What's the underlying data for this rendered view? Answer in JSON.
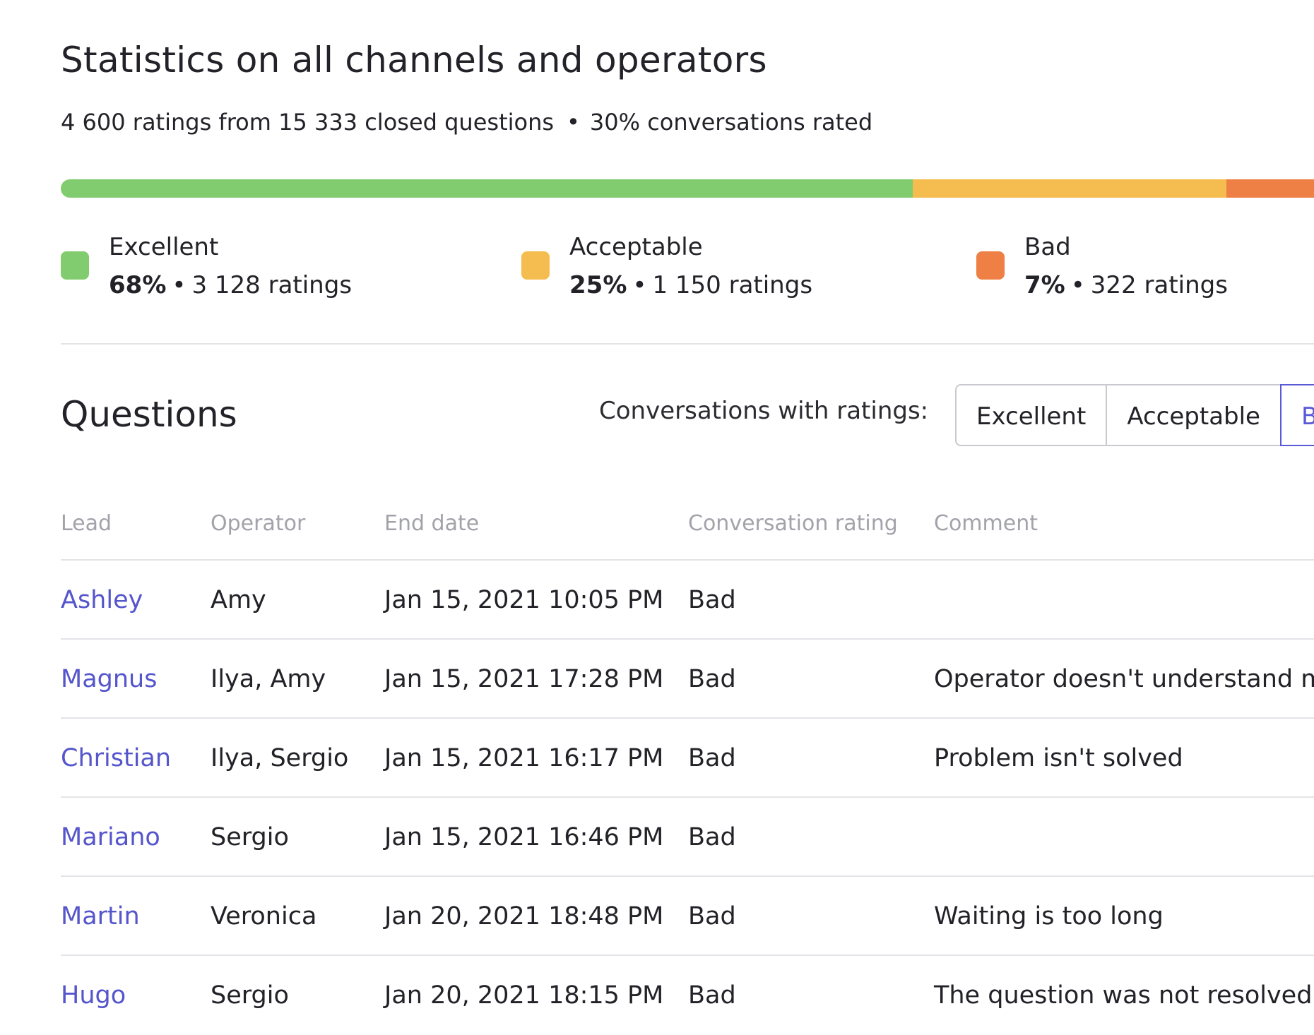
{
  "title": "Statistics on all channels and operators",
  "summary": {
    "ratings_text": "4 600 ratings from 15 333 closed questions",
    "separator": "•",
    "rated_text": "30% conversations rated"
  },
  "distribution": [
    {
      "name": "Excellent",
      "percent": 68,
      "percent_label": "68%",
      "count_label": "3 128 ratings",
      "color": "#82cc70"
    },
    {
      "name": "Acceptable",
      "percent": 25,
      "percent_label": "25%",
      "count_label": "1 150 ratings",
      "color": "#f5bd4f"
    },
    {
      "name": "Bad",
      "percent": 7,
      "percent_label": "7%",
      "count_label": "322 ratings",
      "color": "#ef8045"
    }
  ],
  "questions": {
    "title": "Questions",
    "filter_label": "Conversations with ratings:",
    "filters": [
      {
        "label": "Excellent",
        "active": false
      },
      {
        "label": "Acceptable",
        "active": false
      },
      {
        "label": "Bad",
        "active": true
      }
    ],
    "columns": [
      "Lead",
      "Operator",
      "End date",
      "Conversation rating",
      "Comment"
    ],
    "rows": [
      {
        "lead": "Ashley",
        "operator": "Amy",
        "end_date": "Jan 15, 2021 10:05 PM",
        "rating": "Bad",
        "comment": ""
      },
      {
        "lead": "Magnus",
        "operator": "Ilya, Amy",
        "end_date": "Jan 15, 2021 17:28 PM",
        "rating": "Bad",
        "comment": "Operator doesn't understand m"
      },
      {
        "lead": "Christian",
        "operator": "Ilya, Sergio",
        "end_date": "Jan 15, 2021 16:17 PM",
        "rating": "Bad",
        "comment": "Problem isn't solved"
      },
      {
        "lead": "Mariano",
        "operator": "Sergio",
        "end_date": "Jan 15, 2021 16:46 PM",
        "rating": "Bad",
        "comment": ""
      },
      {
        "lead": "Martin",
        "operator": "Veronica",
        "end_date": "Jan 20, 2021 18:48 PM",
        "rating": "Bad",
        "comment": "Waiting is too long"
      },
      {
        "lead": "Hugo",
        "operator": "Sergio",
        "end_date": "Jan 20, 2021 18:15 PM",
        "rating": "Bad",
        "comment": "The question was not resolved."
      }
    ]
  }
}
